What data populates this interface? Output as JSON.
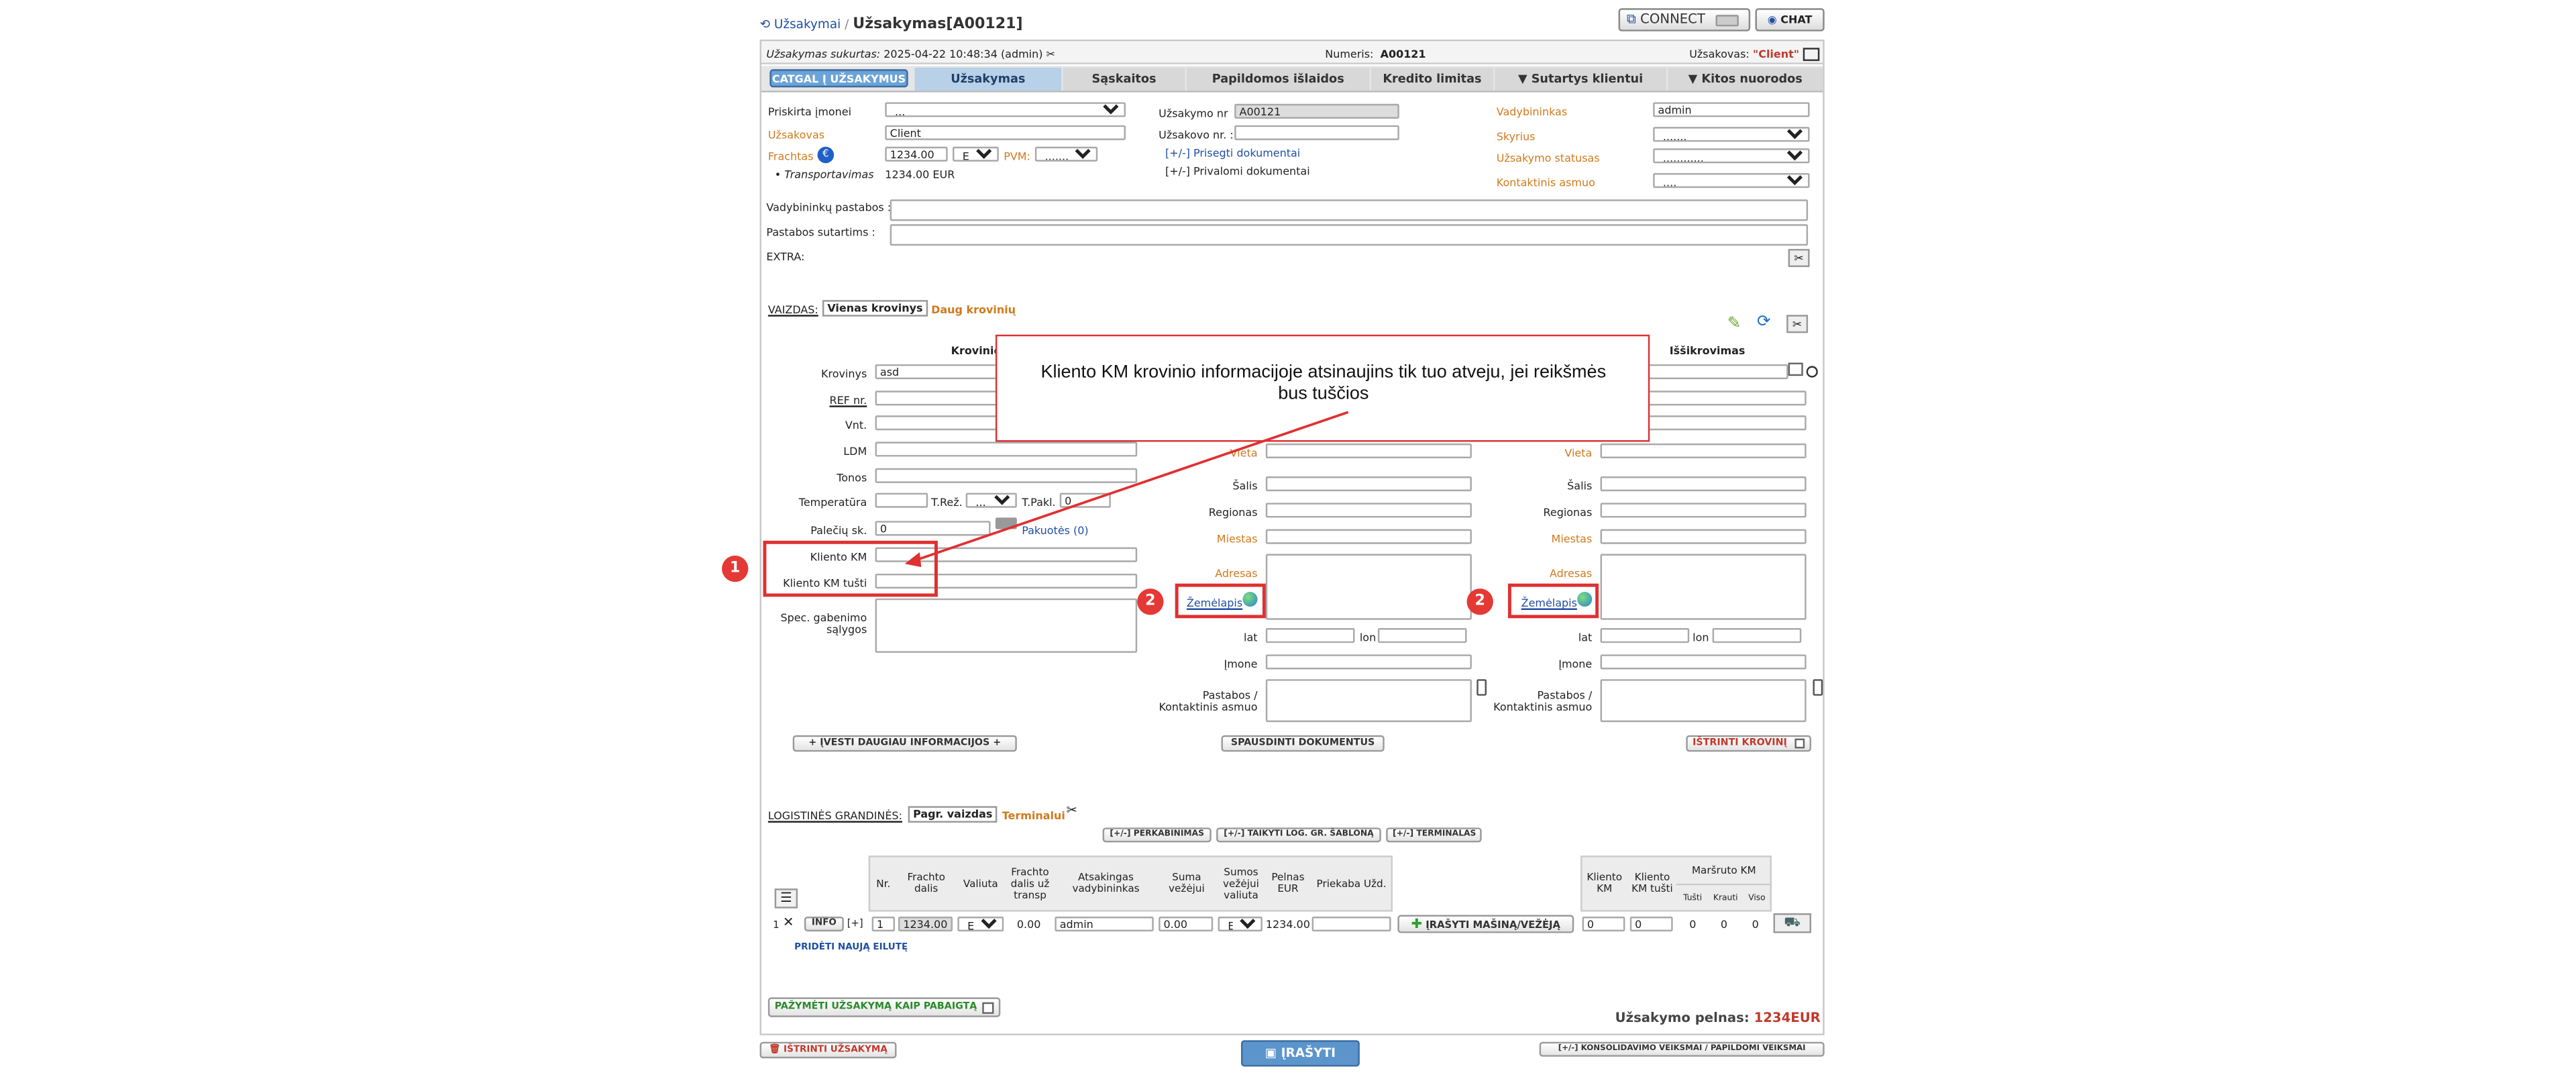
{
  "breadcrumb": {
    "parent": "Užsakymai",
    "sep": "/",
    "title": "Užsakymas[A00121]"
  },
  "topbar": {
    "connect": "CONNECT",
    "chat": "CHAT"
  },
  "info": {
    "created_label": "Užsakymas sukurtas:",
    "created_value": "2025-04-22 10:48:34 (admin)",
    "number_label": "Numeris:",
    "number_value": "A00121",
    "customer_label": "Užsakovas:",
    "customer_value": "\"Client\""
  },
  "tabs": [
    "CATGAL Į UŽSAKYMUS",
    "Užsakymas",
    "Sąskaitos",
    "Papildomos išlaidos",
    "Kredito limitas",
    "▼ Sutartys klientui",
    "▼ Kitos nuorodos"
  ],
  "form": {
    "company_label": "Priskirta įmonei",
    "company_value": "...",
    "customer_label": "Užsakovas",
    "customer_value": "Client",
    "freight_label": "Frachtas",
    "freight_value": "1234.00",
    "currency": "EUR",
    "vat_label": "PVM:",
    "vat_value": ".......",
    "transport_label": "Transportavimas",
    "transport_value": "1234.00 EUR",
    "order_nr_label": "Užsakymo nr",
    "order_nr_value": "A00121",
    "customer_nr_label": "Užsakovo nr. :",
    "customer_nr_value": "",
    "attached_docs": "[+/-] Prisegti dokumentai",
    "private_docs": "[+/-] Privalomi dokumentai",
    "manager_label": "Vadybininkas",
    "manager_value": "admin",
    "department_label": "Skyrius",
    "department_value": ".......",
    "status_label": "Užsakymo statusas",
    "status_value": "............",
    "contact_label": "Kontaktinis asmuo",
    "contact_value": "....",
    "mgr_notes_label": "Vadybininkų pastabos :",
    "contract_notes_label": "Pastabos sutartims :",
    "extra_label": "EXTRA:"
  },
  "view": {
    "label": "VAIZDAS:",
    "single": "Vienas krovinys",
    "multi": "Daug krovinių"
  },
  "cargo": {
    "col_cargo": "Krovinio",
    "col_unload": "Iššikrovimas",
    "cargo_label": "Krovinys",
    "cargo_value": "asd",
    "ref_label": "REF nr.",
    "vnt_label": "Vnt.",
    "ldm_label": "LDM",
    "tons_label": "Tonos",
    "temp_label": "Temperatūra",
    "treg_label": "T.Rež.",
    "treg_value": "...",
    "tpakl_label": "T.Pakl.",
    "tpakl_value": "0",
    "pallets_label": "Palečių sk.",
    "pallets_value": "0",
    "packages": "Pakuotės (0)",
    "km_label": "Kliento KM",
    "km_empty_label": "Kliento KM tušti",
    "special_label": "Spec. gabenimo sąlygos",
    "more_info": "+ ĮVESTI DAUGIAU INFORMACIJOS +"
  },
  "loc": {
    "place": "Vieta",
    "country": "Šalis",
    "region": "Regionas",
    "city": "Miestas",
    "address": "Adresas",
    "map": "Žemėlapis",
    "lat": "lat",
    "lon": "lon",
    "company": "Įmone",
    "notes": "Pastabos / Kontaktinis asmuo"
  },
  "print_docs": "SPAUSDINTI DOKUMENTUS",
  "delete_cargo": "IŠTRINTI KROVINĮ",
  "callout": {
    "text": "Kliento KM krovinio informacijoje atsinaujins tik tuo atveju, jei reikšmės bus tuščios",
    "badge1": "1",
    "badge2": "2"
  },
  "logistics": {
    "label": "LOGISTINĖS GRANDINĖS:",
    "basic": "Pagr. vaizdas",
    "terminals": "Terminalui",
    "reload": "[+/-] PERKABINIMAS",
    "template": "[+/-] TAIKYTI LOG. GR. ŠABLONĄ",
    "terminals_btn": "[+/-] TERMINALAS"
  },
  "table": {
    "headers": [
      "Nr.",
      "Frachto dalis",
      "Valiuta",
      "Frachto dalis už transp",
      "Atsakingas vadybininkas",
      "Suma vežėjui",
      "Sumos vežėjui valiuta",
      "Pelnas EUR",
      "Priekaba Užd.",
      "Kliento KM",
      "Kliento KM tušti",
      "Maršruto KM"
    ],
    "sub_headers": [
      "Tušti",
      "Krauti",
      "Viso"
    ],
    "row": {
      "idx": "1",
      "info": "INFO",
      "plus": "[+]",
      "nr": "1",
      "freight": "1234.00",
      "currency": "EUR",
      "freight_transp": "0.00",
      "manager": "admin",
      "sum": "0.00",
      "sum_currency": "EUR",
      "profit": "1234.00",
      "km": "0",
      "km_empty": "0",
      "empty": "0",
      "loaded": "0",
      "total": "0",
      "vehicle_btn": "ĮRAŠYTI MAŠINĄ/VEŽĖJĄ"
    },
    "add_row": "PRIDĖTI NAUJĄ EILUTĘ"
  },
  "mark_done": "PAŽYMĖTI UŽSAKYMĄ KAIP PABAIGTĄ",
  "profit": {
    "label": "Užsakymo pelnas:",
    "value": "1234EUR"
  },
  "footer": {
    "delete_order": "IŠTRINTI UŽSAKYMĄ",
    "save": "ĮRAŠYTI",
    "consolidate": "[+/-] KONSOLIDAVIMO VEIKSMAI / PAPILDOMI VEIKSMAI"
  }
}
